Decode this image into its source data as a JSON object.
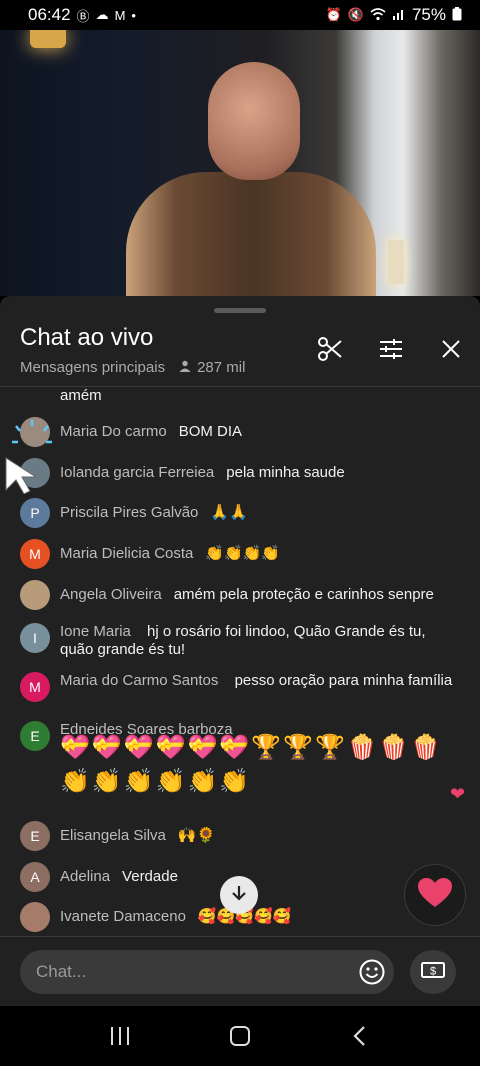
{
  "status_bar": {
    "time": "06:42",
    "battery": "75%",
    "left_icons": [
      "b-icon",
      "cloud-icon",
      "gmail-icon",
      "dot-icon"
    ],
    "right_icons": [
      "alarm-icon",
      "mute-icon",
      "wifi-icon",
      "signal-icon",
      "battery-icon"
    ]
  },
  "chat_panel": {
    "title": "Chat ao vivo",
    "filter_label": "Mensagens principais",
    "viewer_count": "287 mil",
    "header_buttons": [
      "scissors-icon",
      "tune-icon",
      "close-icon"
    ]
  },
  "messages": [
    {
      "author": "",
      "text": "amém",
      "avatar_letter": "",
      "avatar_color": "#00000000"
    },
    {
      "author": "Maria Do carmo",
      "text": "BOM DIA",
      "avatar_letter": "",
      "avatar_color": "#9b8b7e"
    },
    {
      "author": "Iolanda garcia Ferreiea",
      "text": "pela minha saude",
      "avatar_letter": "",
      "avatar_color": "#6b7b86"
    },
    {
      "author": "Priscila Pires Galvão",
      "text": "🙏🙏",
      "avatar_letter": "P",
      "avatar_color": "#5c7a9c"
    },
    {
      "author": "Maria Dielicia Costa",
      "text": "👏👏👏👏",
      "avatar_letter": "M",
      "avatar_color": "#e65123"
    },
    {
      "author": "Angela Oliveira",
      "text": "amém pela proteção e carinhos senpre",
      "avatar_letter": "",
      "avatar_color": "#b79a7a"
    },
    {
      "author": "Ione Maria",
      "text": "hj o rosário foi lindoo, Quão Grande és tu, quão grande és tu!",
      "avatar_letter": "I",
      "avatar_color": "#78909c"
    },
    {
      "author": "Maria do Carmo Santos",
      "text": "pesso oração para minha família",
      "avatar_letter": "M",
      "avatar_color": "#d81b60"
    },
    {
      "author": "Edneides Soares barboza",
      "text": "💝💝💝💝💝💝🏆🏆🏆🍿🍿🍿👏👏👏👏👏👏",
      "avatar_letter": "E",
      "avatar_color": "#2e7d32"
    },
    {
      "author": "Elisangela Silva",
      "text": "🙌🌻",
      "avatar_letter": "E",
      "avatar_color": "#8d6e63"
    },
    {
      "author": "Adelina",
      "text": "Verdade",
      "avatar_letter": "A",
      "avatar_color": "#8d6e63"
    },
    {
      "author": "Ivanete Damaceno",
      "text": "🥰🥰🥰🥰🥰",
      "avatar_letter": "",
      "avatar_color": "#a57c6a"
    }
  ],
  "input": {
    "placeholder": "Chat..."
  },
  "colors": {
    "panel_bg": "#212121",
    "heart_red": "#e9436b"
  }
}
